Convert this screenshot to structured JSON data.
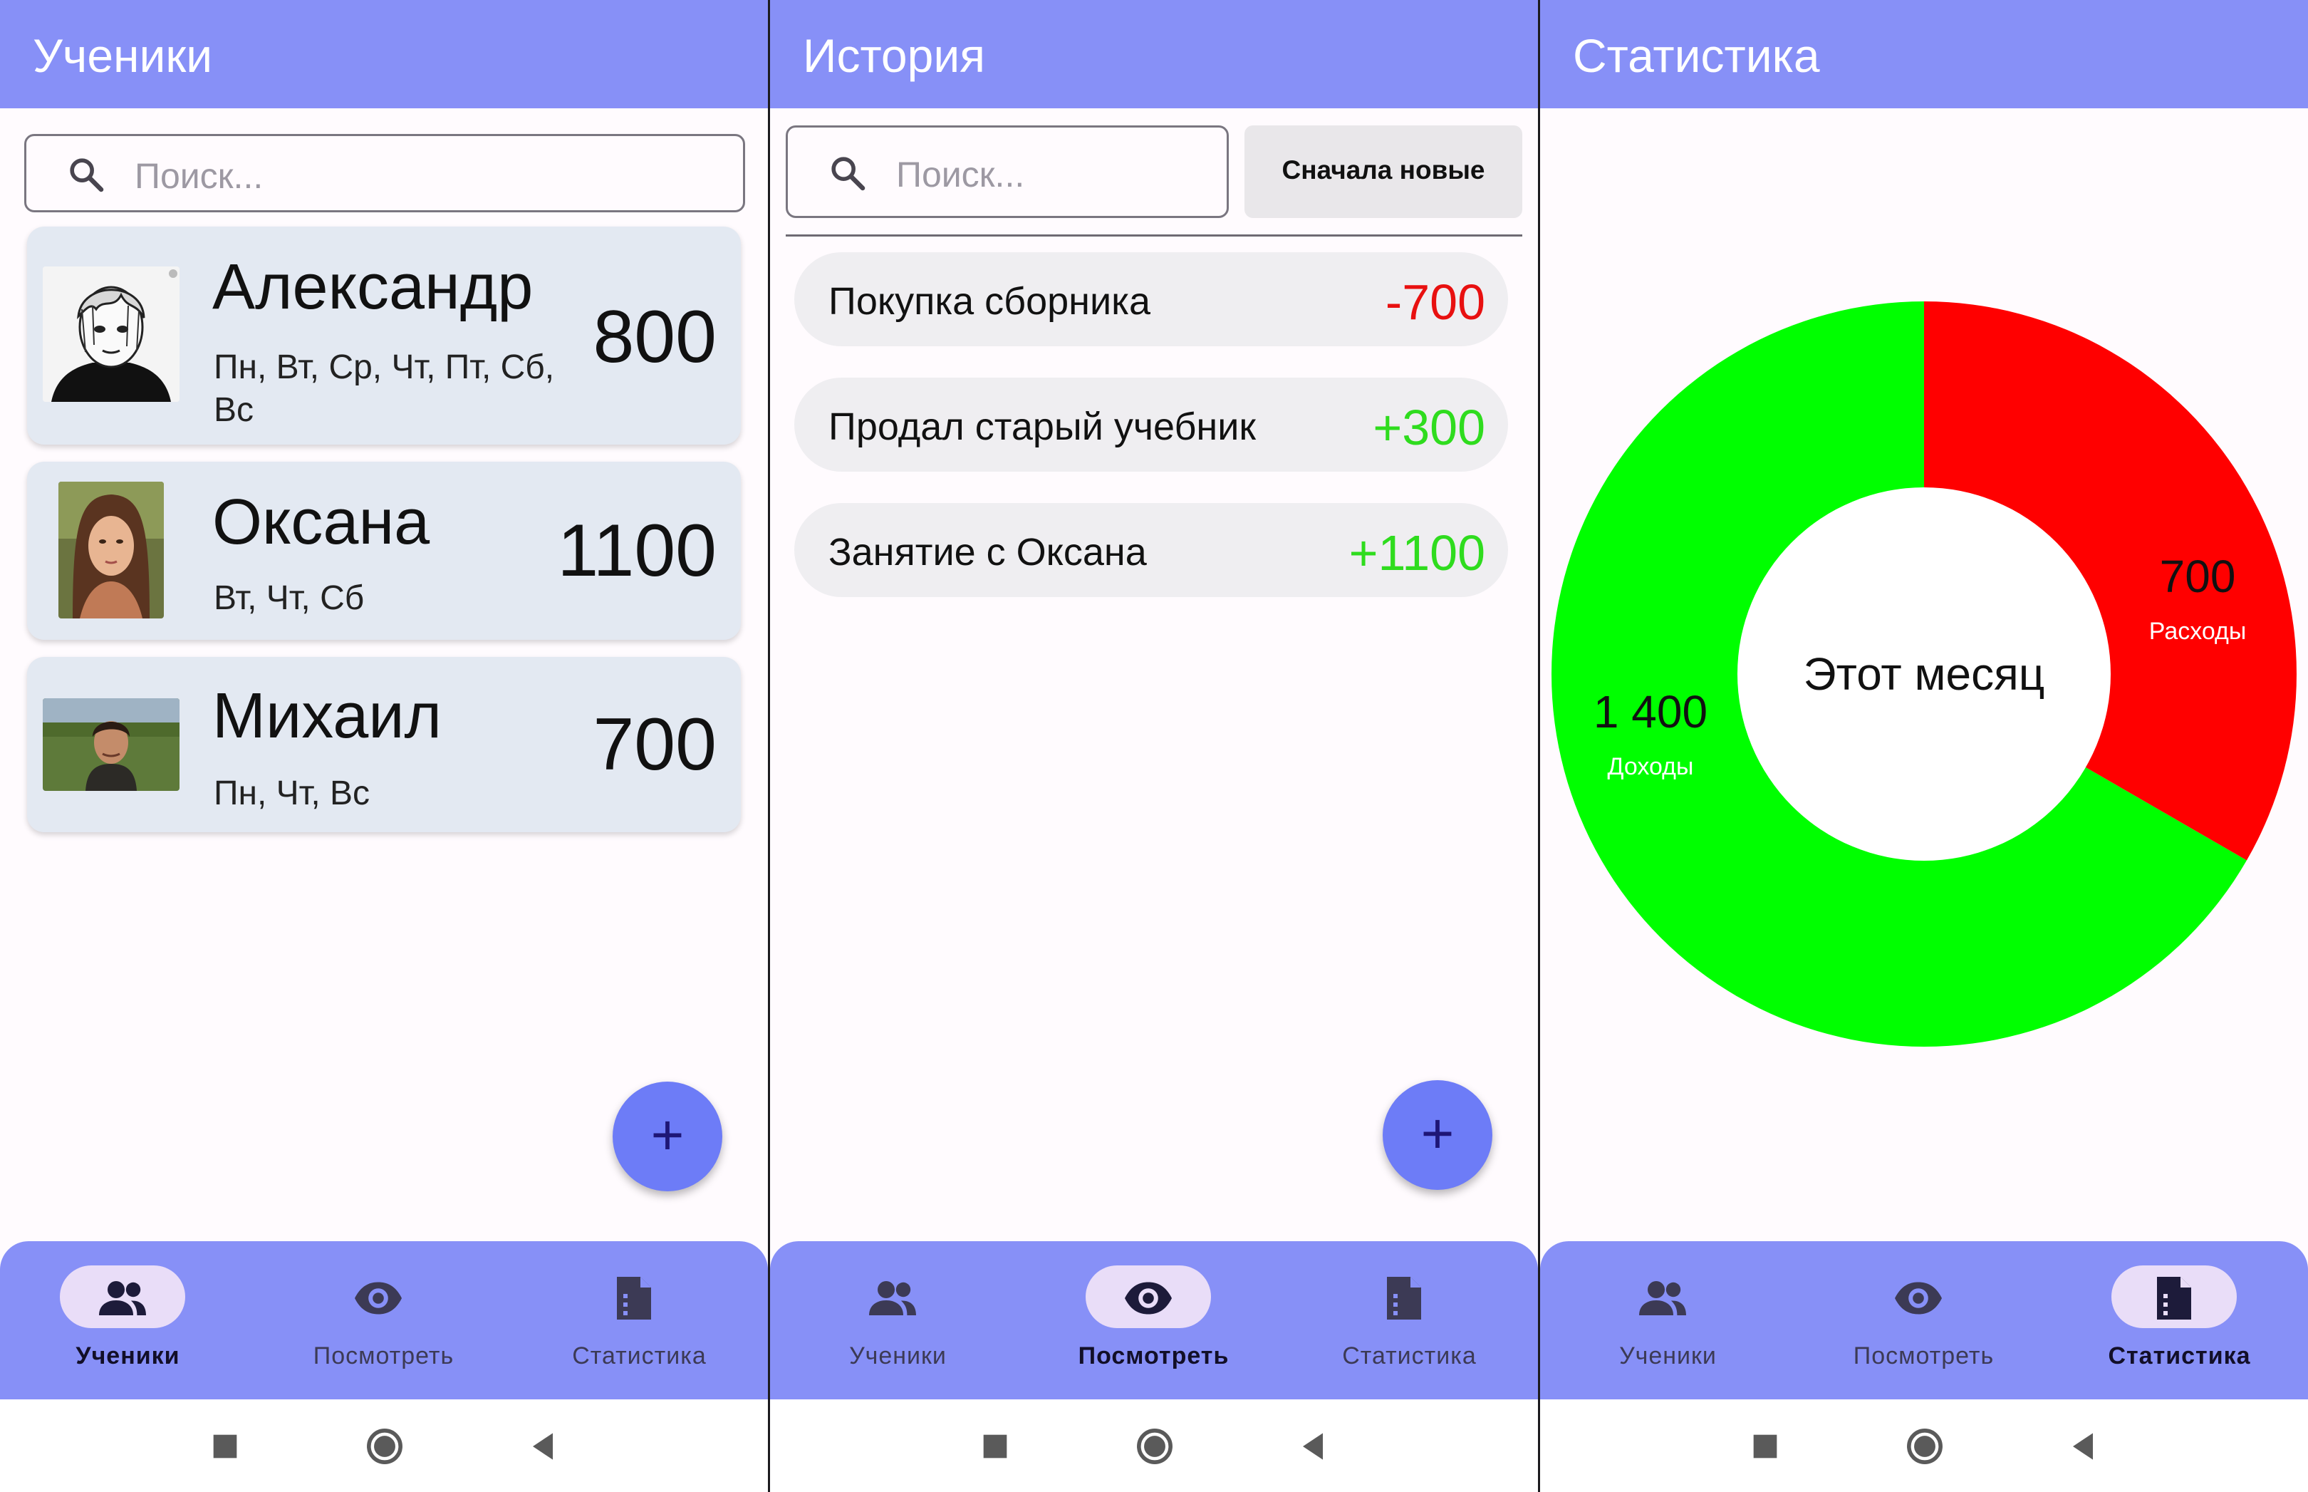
{
  "colors": {
    "app_bar": "#8790f7",
    "card": "#e3e9f2",
    "fab": "#6d7cf7",
    "income": "#00ff00",
    "expense": "#ff0000"
  },
  "nav": {
    "students": "Ученики",
    "view": "Посмотреть",
    "stats": "Статистика"
  },
  "students_screen": {
    "title": "Ученики",
    "search_placeholder": "Поиск...",
    "students": [
      {
        "name": "Александр",
        "days": "Пн, Вт, Ср, Чт, Пт, Сб, Вс",
        "amount": "800"
      },
      {
        "name": "Оксана",
        "days": "Вт, Чт, Сб",
        "amount": "1100"
      },
      {
        "name": "Михаил",
        "days": "Пн, Чт, Вс",
        "amount": "700"
      }
    ],
    "fab_icon": "+",
    "active_tab": "students"
  },
  "history_screen": {
    "title": "История",
    "search_placeholder": "Поиск...",
    "sort_label": "Сначала новые",
    "items": [
      {
        "title": "Покупка сборника",
        "amount": "-700",
        "kind": "expense"
      },
      {
        "title": "Продал старый учебник",
        "amount": "+300",
        "kind": "income"
      },
      {
        "title": "Занятие с Оксана",
        "amount": "+1100",
        "kind": "income"
      }
    ],
    "fab_icon": "+",
    "active_tab": "view"
  },
  "stats_screen": {
    "title": "Статистика",
    "center_label": "Этот месяц",
    "active_tab": "stats"
  },
  "chart_data": {
    "type": "pie",
    "title": "Этот месяц",
    "slices": [
      {
        "label": "Расходы",
        "value": 700,
        "value_label": "700",
        "color": "#ff0000"
      },
      {
        "label": "Доходы",
        "value": 1400,
        "value_label": "1 400",
        "color": "#00ff00"
      }
    ],
    "donut": true
  }
}
